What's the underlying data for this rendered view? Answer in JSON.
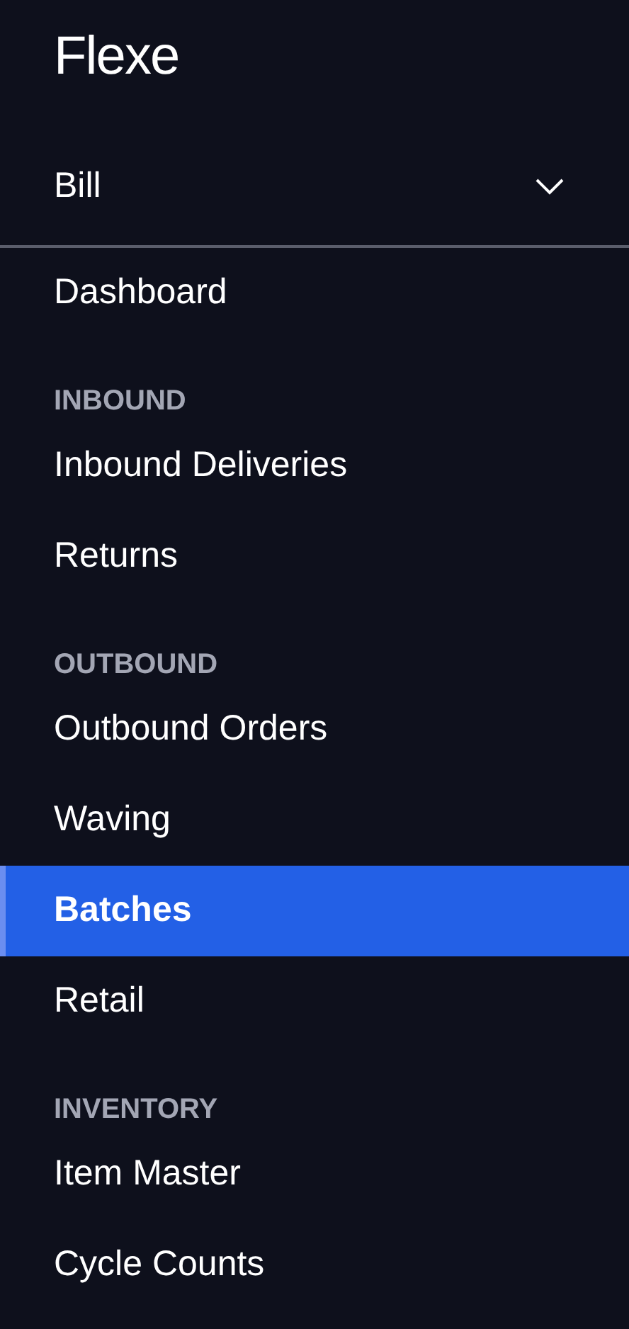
{
  "logo": "Flexe",
  "account": {
    "name": "Bill",
    "expanded": false
  },
  "nav": [
    {
      "kind": "item",
      "label": "Dashboard",
      "selected": false
    },
    {
      "kind": "header",
      "label": "INBOUND"
    },
    {
      "kind": "item",
      "label": "Inbound Deliveries",
      "selected": false
    },
    {
      "kind": "item",
      "label": "Returns",
      "selected": false
    },
    {
      "kind": "header",
      "label": "OUTBOUND"
    },
    {
      "kind": "item",
      "label": "Outbound Orders",
      "selected": false
    },
    {
      "kind": "item",
      "label": "Waving",
      "selected": false
    },
    {
      "kind": "item",
      "label": "Batches",
      "selected": true
    },
    {
      "kind": "item",
      "label": "Retail",
      "selected": false
    },
    {
      "kind": "header",
      "label": "INVENTORY"
    },
    {
      "kind": "item",
      "label": "Item Master",
      "selected": false
    },
    {
      "kind": "item",
      "label": "Cycle Counts",
      "selected": false
    }
  ]
}
